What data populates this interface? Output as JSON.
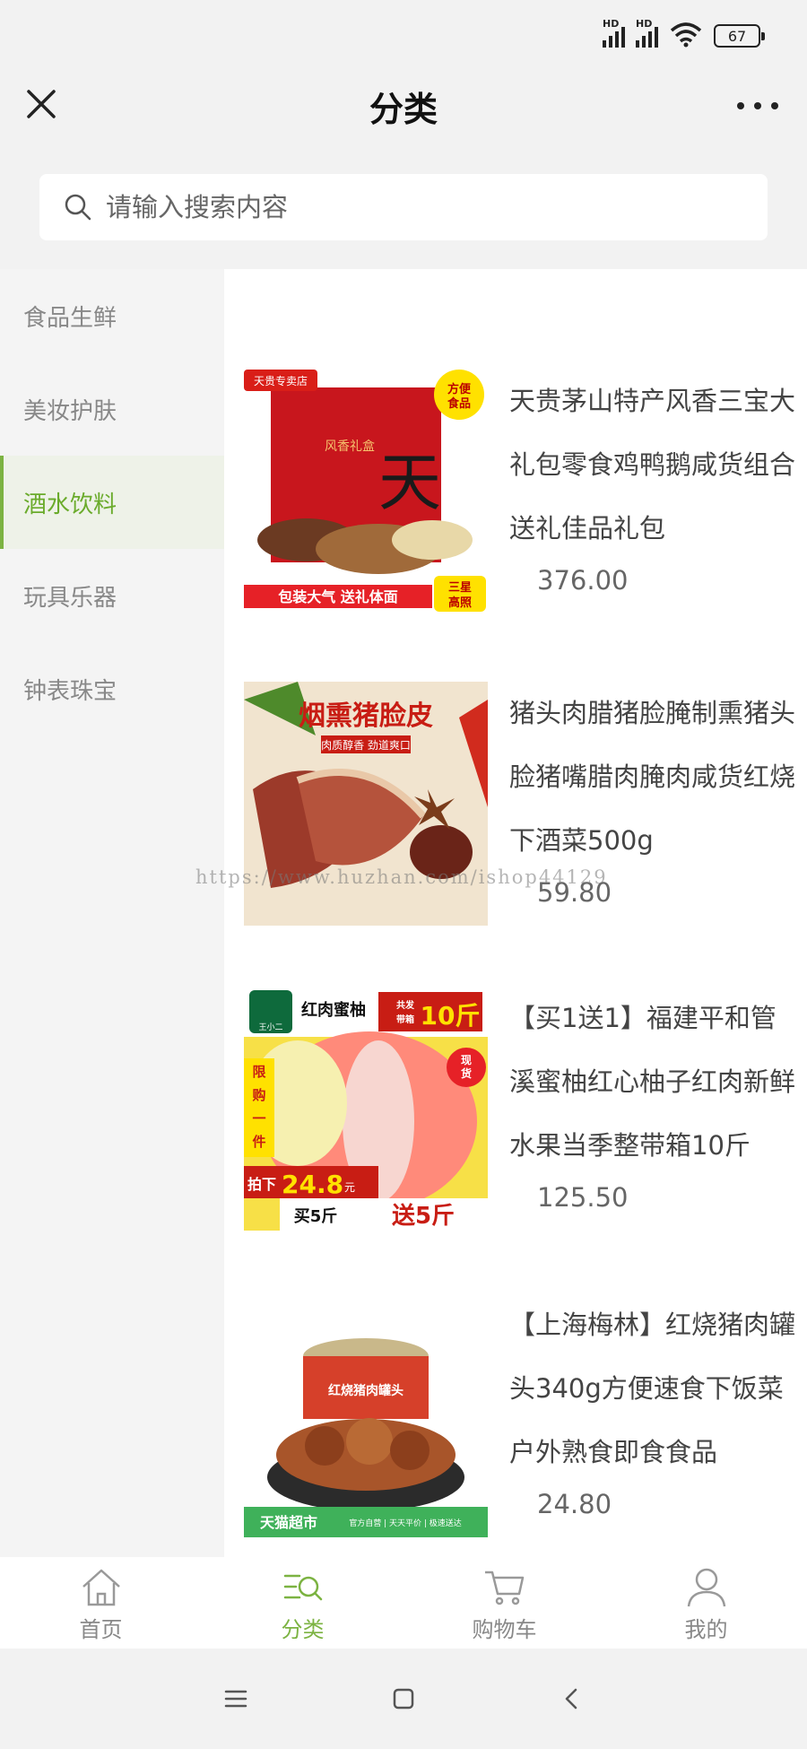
{
  "status_bar": {
    "hd_label": "HD",
    "battery": "67"
  },
  "nav": {
    "title": "分类"
  },
  "search": {
    "placeholder": "请输入搜索内容"
  },
  "categories": [
    {
      "label": "食品生鲜",
      "active": false
    },
    {
      "label": "美妆护肤",
      "active": false
    },
    {
      "label": "酒水饮料",
      "active": true
    },
    {
      "label": "玩具乐器",
      "active": false
    },
    {
      "label": "钟表珠宝",
      "active": false
    }
  ],
  "products": [
    {
      "name": "天贵茅山特产风香三宝大礼包零食鸡鸭鹅咸货组合送礼佳品礼包",
      "price": "376.00",
      "image_text": {
        "badge": "天贵专卖店",
        "corner": "方便食品",
        "box": "风香礼盒",
        "banner": "包装大气 送礼体面",
        "seal": "三星高照"
      }
    },
    {
      "name": "猪头肉腊猪脸腌制熏猪头脸猪嘴腊肉腌肉咸货红烧下酒菜500g",
      "price": "59.80",
      "image_text": {
        "title": "烟熏猪脸皮",
        "subtitle": "肉质醇香 劲道爽口"
      }
    },
    {
      "name": "【买1送1】福建平和管溪蜜柚红心柚子红肉新鲜水果当季整带箱10斤",
      "price": "125.50",
      "image_text": {
        "title": "红肉蜜柚",
        "tag": "共发带箱",
        "weight": "10斤",
        "stock": "现货",
        "limit": "限购一件",
        "price_label": "拍下",
        "price_value": "24.8",
        "price_unit": "元",
        "promo_buy": "买5斤",
        "promo_get": "送5斤",
        "brand": "王小二"
      }
    },
    {
      "name": "【上海梅林】红烧猪肉罐头340g方便速食下饭菜户外熟食即食食品",
      "price": "24.80",
      "image_text": {
        "can_label": "红烧猪肉罐头",
        "store": "天猫超市",
        "badges": "官方自营 | 天天平价 | 极速送达"
      }
    }
  ],
  "watermark": "https://www.huzhan.com/ishop44129",
  "tabbar": [
    {
      "label": "首页",
      "icon": "home-icon",
      "active": false
    },
    {
      "label": "分类",
      "icon": "category-search-icon",
      "active": true
    },
    {
      "label": "购物车",
      "icon": "cart-icon",
      "active": false
    },
    {
      "label": "我的",
      "icon": "user-icon",
      "active": false
    }
  ],
  "colors": {
    "accent": "#7cb342",
    "text": "#444444",
    "muted": "#888888",
    "background": "#f2f2f2"
  }
}
